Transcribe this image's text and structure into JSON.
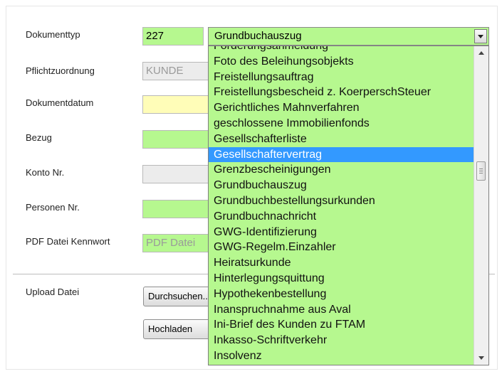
{
  "form": {
    "dokumenttyp_label": "Dokumenttyp",
    "dokumenttyp_code": "227",
    "pflichtzuordnung_label": "Pflichtzuordnung",
    "pflichtzuordnung_value": "KUNDE",
    "dokumentdatum_label": "Dokumentdatum",
    "bezug_label": "Bezug",
    "konto_label": "Konto Nr.",
    "personen_label": "Personen Nr.",
    "pdf_label": "PDF Datei Kennwort",
    "pdf_placeholder": "PDF Datei",
    "upload_label": "Upload Datei",
    "browse_button": "Durchsuchen...",
    "upload_button": "Hochladen"
  },
  "select": {
    "value": "Grundbuchauszug",
    "options": [
      "Forderungsanmeldung",
      "Foto des Beleihungsobjekts",
      "Freistellungsauftrag",
      "Freistellungsbescheid z. KoerperschSteuer",
      "Gerichtliches Mahnverfahren",
      "geschlossene Immobilienfonds",
      "Gesellschafterliste",
      "Gesellschaftervertrag",
      "Grenzbescheinigungen",
      "Grundbuchauszug",
      "Grundbuchbestellungsurkunden",
      "Grundbuchnachricht",
      "GWG-Identifizierung",
      "GWG-Regelm.Einzahler",
      "Heiratsurkunde",
      "Hinterlegungsquittung",
      "Hypothekenbestellung",
      "Inanspruchnahme aus Aval",
      "Ini-Brief des Kunden zu FTAM",
      "Inkasso-Schriftverkehr",
      "Insolvenz"
    ],
    "highlighted": "Gesellschaftervertrag"
  },
  "colors": {
    "field_green": "#b6f88f",
    "highlight": "#3399ff",
    "date_yellow": "#fffdb8"
  }
}
